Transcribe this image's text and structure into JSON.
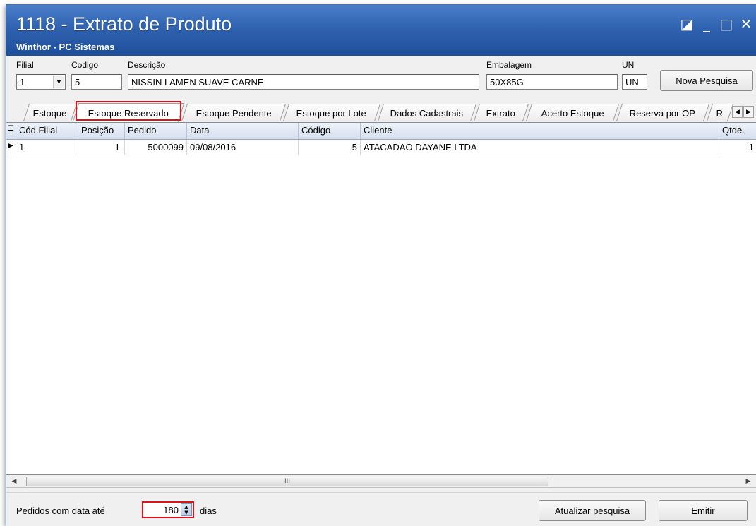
{
  "window": {
    "title": "1118 - Extrato de Produto",
    "subtitle": "Winthor - PC Sistemas",
    "controls": {
      "restore": "◪",
      "minimize": "_",
      "maximize": "□",
      "close": "✕"
    }
  },
  "form": {
    "filial_label": "Filial",
    "filial_value": "1",
    "codigo_label": "Codigo",
    "codigo_value": "5",
    "descricao_label": "Descrição",
    "descricao_value": "NISSIN LAMEN SUAVE CARNE",
    "embalagem_label": "Embalagem",
    "embalagem_value": "50X85G",
    "un_label": "UN",
    "un_value": "UN",
    "nova_pesquisa_label": "Nova Pesquisa"
  },
  "tabs": [
    {
      "label": "Estoque"
    },
    {
      "label": "Estoque Reservado",
      "active": true
    },
    {
      "label": "Estoque Pendente"
    },
    {
      "label": "Estoque por Lote"
    },
    {
      "label": "Dados Cadastrais"
    },
    {
      "label": "Extrato"
    },
    {
      "label": "Acerto Estoque"
    },
    {
      "label": "Reserva por OP"
    },
    {
      "label": "R"
    }
  ],
  "grid": {
    "columns": [
      "Cód.Filial",
      "Posição",
      "Pedido",
      "Data",
      "Código",
      "Cliente",
      "Qtde."
    ],
    "rows": [
      {
        "cod_filial": "1",
        "posicao": "L",
        "pedido": "5000099",
        "data": "09/08/2016",
        "codigo": "5",
        "cliente": "ATACADAO DAYANE LTDA",
        "qtde": "1"
      }
    ],
    "scroll_grip": "III"
  },
  "footer": {
    "pedidos_label": "Pedidos com data até",
    "dias_value": "180",
    "dias_label": "dias",
    "atualizar_label": "Atualizar pesquisa",
    "emitir_label": "Emitir"
  },
  "colors": {
    "title_bg": "#2f62b0",
    "highlight": "#e0111b",
    "grid_header": "#d6e0ee"
  }
}
